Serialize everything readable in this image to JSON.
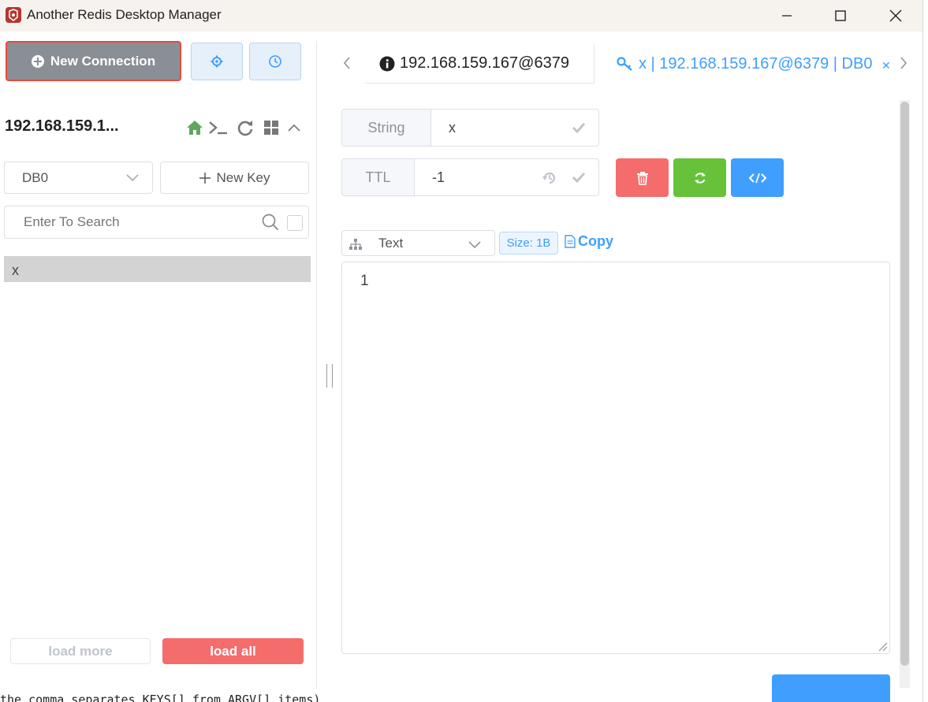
{
  "window": {
    "title": "Another Redis Desktop Manager",
    "controls": [
      "minimize",
      "maximize",
      "close"
    ]
  },
  "sidebar": {
    "new_connection_label": "New Connection",
    "connection_name": "192.168.159.1...",
    "db_select": {
      "value": "DB0"
    },
    "new_key_label": "New Key",
    "search": {
      "placeholder": "Enter To Search",
      "value": ""
    },
    "keys": [
      "x"
    ],
    "load_more_label": "load more",
    "load_all_label": "load all"
  },
  "tabs": {
    "info_tab_label": "192.168.159.167@6379",
    "key_tab_label": "x | 192.168.159.167@6379 | DB0"
  },
  "key_detail": {
    "type_label": "String",
    "key_name": "x",
    "ttl_label": "TTL",
    "ttl_value": "-1",
    "format": "Text",
    "size_label": "Size: 1B",
    "copy_label": "Copy",
    "value": "1"
  },
  "bottom_text": "the comma separates KEYS[] from ARGV[] items)",
  "colors": {
    "accent": "#409eff",
    "danger": "#f56c6c",
    "success": "#67c23a",
    "home_icon": "#5ea85e"
  },
  "icons": {
    "home": "home-icon",
    "terminal": "terminal-icon",
    "refresh": "refresh-icon",
    "grid": "grid-icon",
    "collapse": "chevron-up-icon"
  }
}
